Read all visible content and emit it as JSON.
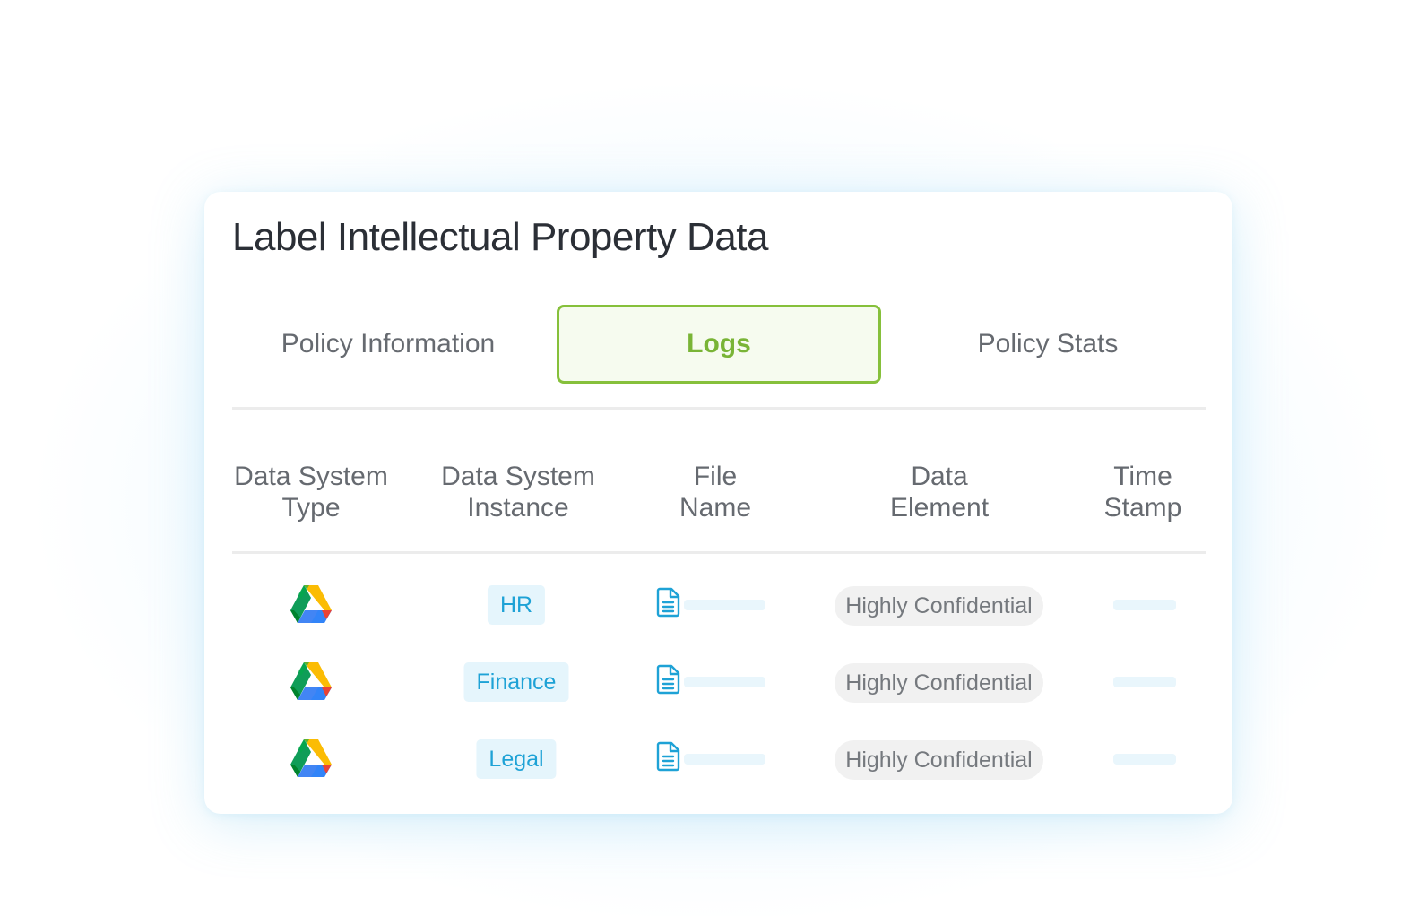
{
  "title": "Label Intellectual Property Data",
  "tabs": [
    {
      "label": "Policy Information",
      "active": false
    },
    {
      "label": "Logs",
      "active": true
    },
    {
      "label": "Policy Stats",
      "active": false
    }
  ],
  "table": {
    "columns": [
      {
        "line1": "Data System",
        "line2": "Type"
      },
      {
        "line1": "Data System",
        "line2": "Instance"
      },
      {
        "line1": "File",
        "line2": "Name"
      },
      {
        "line1": "Data",
        "line2": "Element"
      },
      {
        "line1": "Time",
        "line2": "Stamp"
      }
    ],
    "rows": [
      {
        "system_type_icon": "google-drive-icon",
        "instance": "HR",
        "file_icon": "document-icon",
        "data_element": "Highly Confidential"
      },
      {
        "system_type_icon": "google-drive-icon",
        "instance": "Finance",
        "file_icon": "document-icon",
        "data_element": "Highly Confidential"
      },
      {
        "system_type_icon": "google-drive-icon",
        "instance": "Legal",
        "file_icon": "document-icon",
        "data_element": "Highly Confidential"
      }
    ]
  },
  "colors": {
    "active_tab_border": "#86c03b",
    "active_tab_text": "#79b436",
    "instance_pill_bg": "#e5f5fc",
    "instance_pill_text": "#1ea2d6",
    "element_pill_bg": "#f1f1f1"
  }
}
